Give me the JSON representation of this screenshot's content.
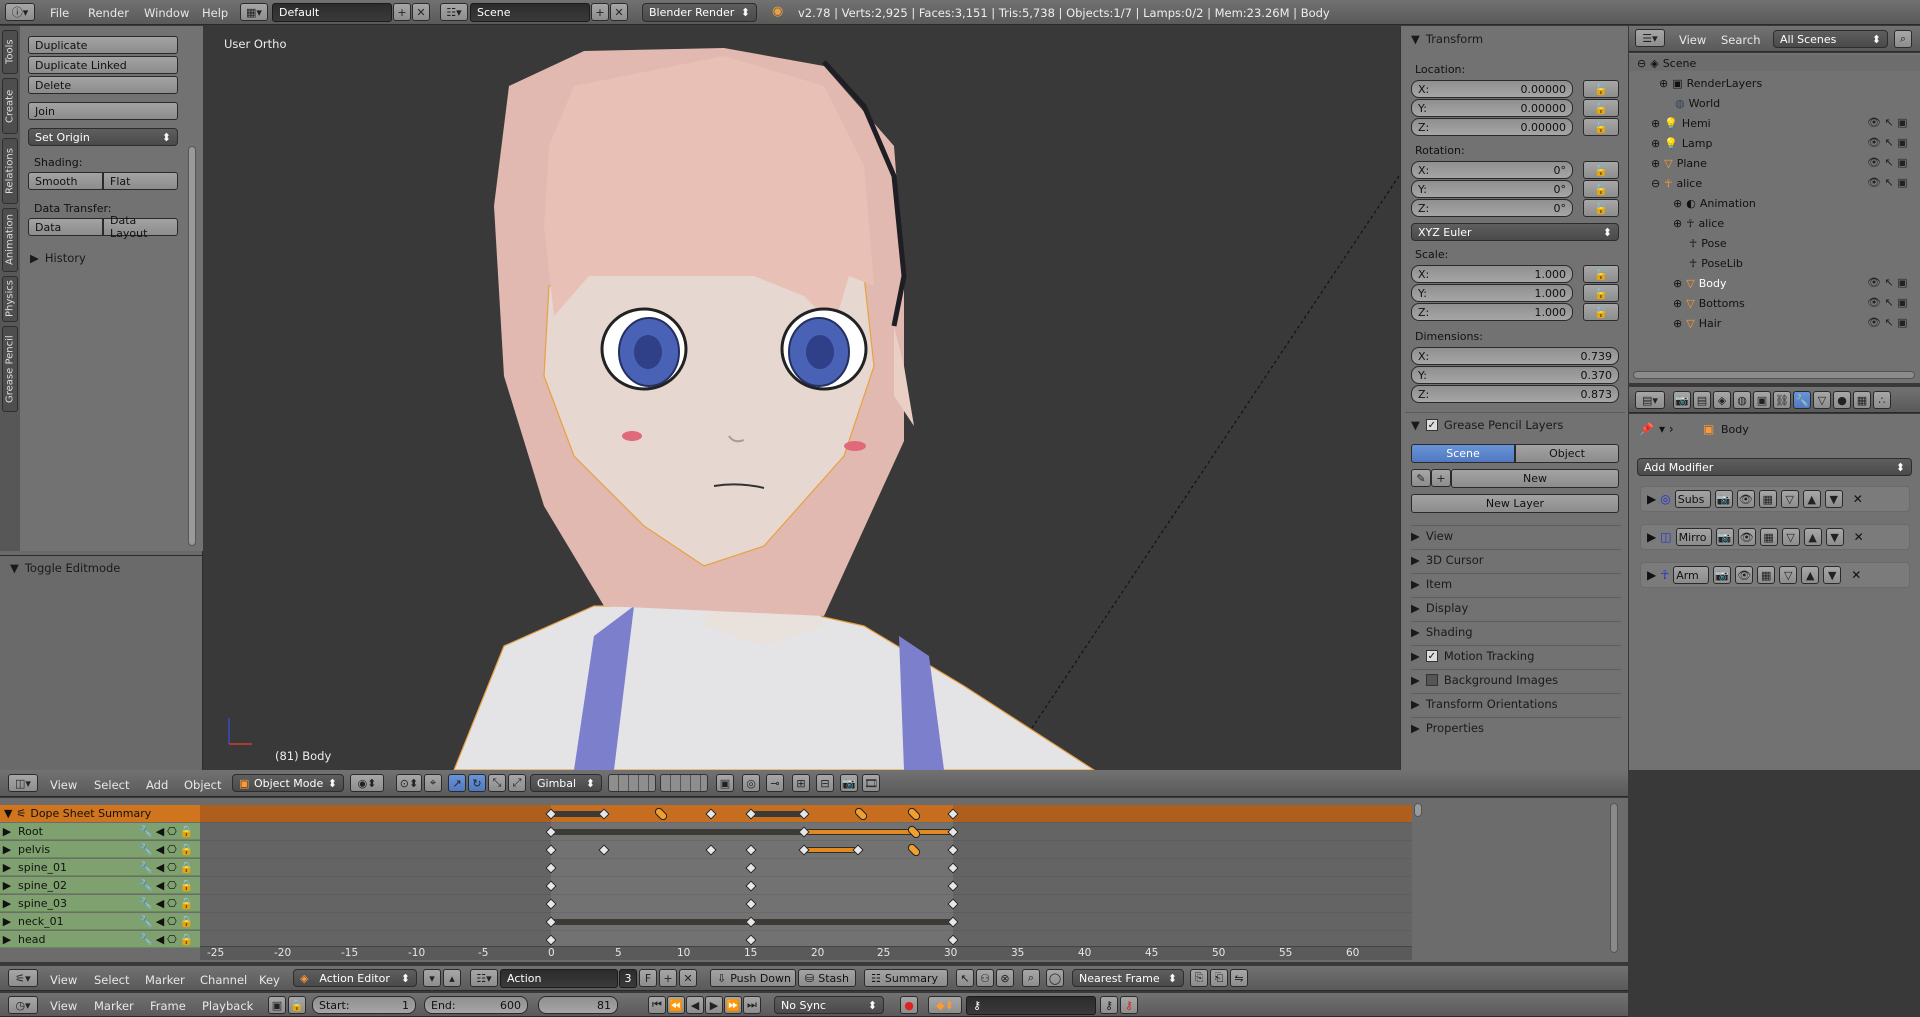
{
  "topbar": {
    "menus": [
      "File",
      "Render",
      "Window",
      "Help"
    ],
    "screen_layout": "Default",
    "scene": "Scene",
    "engine": "Blender Render",
    "stats": "v2.78 | Verts:2,925 | Faces:3,151 | Tris:5,738 | Objects:1/7 | Lamps:0/2 | Mem:23.26M | Body"
  },
  "toolshelf": {
    "tabs": [
      "Tools",
      "Create",
      "Relations",
      "Animation",
      "Physics",
      "Grease Pencil"
    ],
    "buttons": {
      "duplicate": "Duplicate",
      "duplicate_linked": "Duplicate Linked",
      "delete": "Delete",
      "join": "Join",
      "set_origin": "Set Origin"
    },
    "shading_label": "Shading:",
    "smooth": "Smooth",
    "flat": "Flat",
    "data_transfer_label": "Data Transfer:",
    "data": "Data",
    "data_layout": "Data Layout",
    "history": "History",
    "toggle_editmode": "Toggle Editmode"
  },
  "viewport": {
    "view_label": "User Ortho",
    "object_label": "(81) Body",
    "header": {
      "menus": [
        "View",
        "Select",
        "Add",
        "Object"
      ],
      "mode": "Object Mode",
      "orientation": "Gimbal"
    }
  },
  "npanel": {
    "transform": "Transform",
    "location_label": "Location:",
    "location": [
      {
        "axis": "X:",
        "value": "0.00000"
      },
      {
        "axis": "Y:",
        "value": "0.00000"
      },
      {
        "axis": "Z:",
        "value": "0.00000"
      }
    ],
    "rotation_label": "Rotation:",
    "rotation": [
      {
        "axis": "X:",
        "value": "0°"
      },
      {
        "axis": "Y:",
        "value": "0°"
      },
      {
        "axis": "Z:",
        "value": "0°"
      }
    ],
    "rotation_mode": "XYZ Euler",
    "scale_label": "Scale:",
    "scale": [
      {
        "axis": "X:",
        "value": "1.000"
      },
      {
        "axis": "Y:",
        "value": "1.000"
      },
      {
        "axis": "Z:",
        "value": "1.000"
      }
    ],
    "dimensions_label": "Dimensions:",
    "dimensions": [
      {
        "axis": "X:",
        "value": "0.739"
      },
      {
        "axis": "Y:",
        "value": "0.370"
      },
      {
        "axis": "Z:",
        "value": "0.873"
      }
    ],
    "gp_layers": "Grease Pencil Layers",
    "gp_scene": "Scene",
    "gp_object": "Object",
    "gp_new": "New",
    "gp_new_layer": "New Layer",
    "collapsed": [
      "View",
      "3D Cursor",
      "Item",
      "Display",
      "Shading",
      "Motion Tracking",
      "Background Images",
      "Transform Orientations",
      "Properties"
    ]
  },
  "outliner": {
    "view": "View",
    "search": "Search",
    "filter": "All Scenes",
    "items": [
      "Scene",
      "RenderLayers",
      "World",
      "Hemi",
      "Lamp",
      "Plane",
      "alice",
      "Animation",
      "alice",
      "Pose",
      "PoseLib",
      "Body",
      "Bottoms",
      "Hair"
    ]
  },
  "properties": {
    "object_name": "Body",
    "add_modifier": "Add Modifier",
    "modifiers": [
      "Subs",
      "Mirro",
      "Arm"
    ]
  },
  "dopesheet": {
    "summary": "Dope Sheet Summary",
    "channels": [
      "Root",
      "pelvis",
      "spine_01",
      "spine_02",
      "spine_03",
      "neck_01",
      "head"
    ],
    "ruler": [
      "-25",
      "-20",
      "-15",
      "-10",
      "-5",
      "0",
      "5",
      "10",
      "15",
      "20",
      "25",
      "30",
      "35",
      "40",
      "45",
      "50",
      "55",
      "60"
    ],
    "header": {
      "menus": [
        "View",
        "Select",
        "Marker",
        "Channel",
        "Key"
      ],
      "editor": "Action Editor",
      "action": "Action",
      "users": "3",
      "f": "F",
      "push_down": "Push Down",
      "stash": "Stash",
      "summary": "Summary",
      "snap": "Nearest Frame"
    }
  },
  "timeline": {
    "menus": [
      "View",
      "Marker",
      "Frame",
      "Playback"
    ],
    "start_label": "Start:",
    "start": "1",
    "end_label": "End:",
    "end": "600",
    "current": "81",
    "sync": "No Sync"
  }
}
